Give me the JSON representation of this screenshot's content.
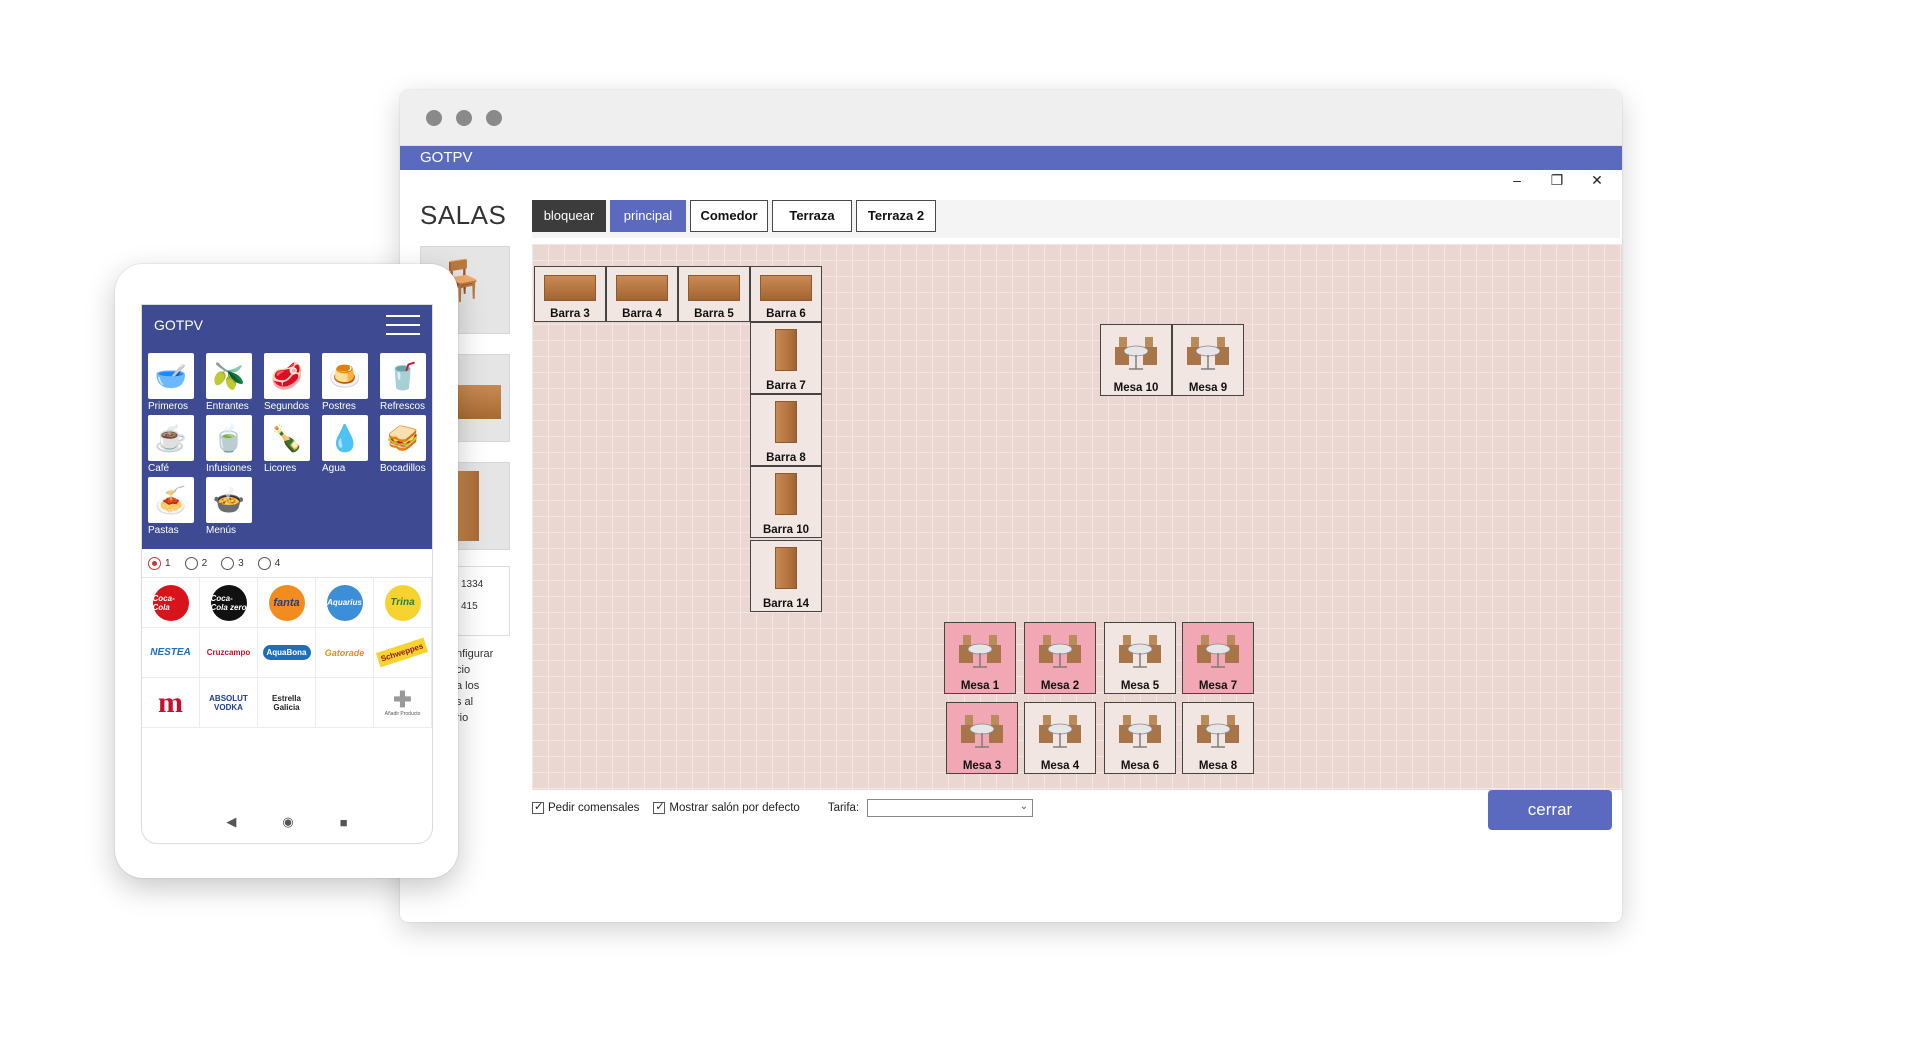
{
  "desktop": {
    "app_title": "GOTPV",
    "window_controls": {
      "minimize": "–",
      "restore": "❐",
      "close": "✕"
    },
    "section_title": "SALAS",
    "tabs": [
      {
        "label": "bloquear",
        "style": "dark"
      },
      {
        "label": "principal",
        "style": "active"
      },
      {
        "label": "Comedor",
        "style": "normal"
      },
      {
        "label": "Terraza",
        "style": "normal"
      },
      {
        "label": "Terraza 2",
        "style": "normal"
      }
    ],
    "left_panel": {
      "box_values": [
        "1334",
        "415"
      ],
      "partial_text": [
        "nfigurar",
        "cio",
        "a los",
        "s al",
        "rio"
      ]
    },
    "barras": [
      "Barra 3",
      "Barra 4",
      "Barra 5",
      "Barra 6",
      "Barra 7",
      "Barra 8",
      "Barra 10",
      "Barra 14"
    ],
    "mesas": [
      {
        "label": "Mesa 10",
        "occupied": false
      },
      {
        "label": "Mesa 9",
        "occupied": false
      },
      {
        "label": "Mesa 1",
        "occupied": true
      },
      {
        "label": "Mesa 2",
        "occupied": true
      },
      {
        "label": "Mesa 5",
        "occupied": false
      },
      {
        "label": "Mesa 7",
        "occupied": true
      },
      {
        "label": "Mesa 3",
        "occupied": true
      },
      {
        "label": "Mesa 4",
        "occupied": false
      },
      {
        "label": "Mesa 6",
        "occupied": false
      },
      {
        "label": "Mesa 8",
        "occupied": false
      }
    ],
    "options": {
      "pedir_comensales": {
        "label": "Pedir comensales",
        "checked": true
      },
      "mostrar_salon": {
        "label": "Mostrar salón por defecto",
        "checked": true
      },
      "tarifa_label": "Tarifa:",
      "tarifa_value": ""
    },
    "close_button": "cerrar",
    "colors": {
      "accent": "#5b6abf",
      "occupied": "#f2a7b4",
      "floor": "#ead7d2"
    }
  },
  "phone": {
    "app_title": "GOTPV",
    "categories": [
      {
        "label": "Primeros",
        "icon": "soup-icon"
      },
      {
        "label": "Entrantes",
        "icon": "olives-icon"
      },
      {
        "label": "Segundos",
        "icon": "meat-icon"
      },
      {
        "label": "Postres",
        "icon": "flan-icon"
      },
      {
        "label": "Refrescos",
        "icon": "soda-can-icon"
      },
      {
        "label": "Café",
        "icon": "coffee-icon"
      },
      {
        "label": "Infusiones",
        "icon": "tea-icon"
      },
      {
        "label": "Licores",
        "icon": "liquor-icon"
      },
      {
        "label": "Agua",
        "icon": "water-bottle-icon"
      },
      {
        "label": "Bocadillos",
        "icon": "sandwich-icon"
      },
      {
        "label": "Pastas",
        "icon": "pasta-icon"
      },
      {
        "label": "Menús",
        "icon": "menu-dish-icon"
      }
    ],
    "radios": [
      {
        "label": "1",
        "selected": true
      },
      {
        "label": "2",
        "selected": false
      },
      {
        "label": "3",
        "selected": false
      },
      {
        "label": "4",
        "selected": false
      }
    ],
    "products": [
      {
        "name": "coca-cola",
        "text": "Coca-Cola"
      },
      {
        "name": "coca-cola-zero",
        "text": "Coca-Cola zero"
      },
      {
        "name": "fanta",
        "text": "fanta"
      },
      {
        "name": "aquarius",
        "text": "Aquarius"
      },
      {
        "name": "trina",
        "text": "Trina"
      },
      {
        "name": "nestea",
        "text": "NESTEA"
      },
      {
        "name": "cruzcampo",
        "text": "Cruzcampo"
      },
      {
        "name": "aquabona",
        "text": "AquaBona"
      },
      {
        "name": "gatorade",
        "text": "Gatorade"
      },
      {
        "name": "schweppes",
        "text": "Schweppes"
      },
      {
        "name": "mahou",
        "text": "m"
      },
      {
        "name": "absolut",
        "text": "ABSOLUT VODKA"
      },
      {
        "name": "estrella-galicia",
        "text": "Estrella Galicia"
      },
      {
        "name": "empty",
        "text": ""
      },
      {
        "name": "add-product",
        "text": "Añadir Producto"
      }
    ],
    "nav": {
      "back": "◀",
      "home": "◉",
      "recent": "■"
    }
  }
}
